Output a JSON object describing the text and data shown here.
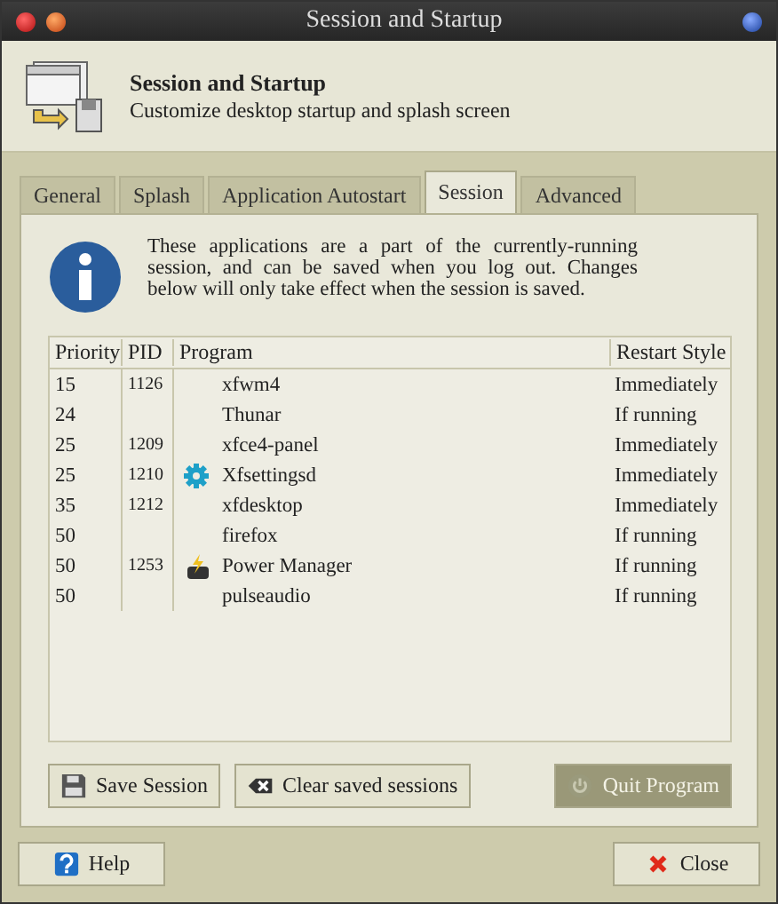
{
  "window": {
    "title": "Session and Startup"
  },
  "header": {
    "title": "Session and Startup",
    "subtitle": "Customize desktop startup and splash screen"
  },
  "tabs": [
    {
      "label": "General",
      "selected": false
    },
    {
      "label": "Splash",
      "selected": false
    },
    {
      "label": "Application Autostart",
      "selected": false
    },
    {
      "label": "Session",
      "selected": true
    },
    {
      "label": "Advanced",
      "selected": false
    }
  ],
  "info": "These applications are a part of the currently-running session, and can be saved when you log out. Changes below will only take effect when the session is saved.",
  "table": {
    "columns": [
      "Priority",
      "PID",
      "Program",
      "Restart Style"
    ],
    "rows": [
      {
        "priority": "15",
        "pid": "1126",
        "program": "xfwm4",
        "restart": "Immediately",
        "kind": "plain"
      },
      {
        "priority": "24",
        "pid": "",
        "program": "Thunar",
        "restart": "If running",
        "kind": "plain"
      },
      {
        "priority": "25",
        "pid": "1209",
        "program": "xfce4-panel",
        "restart": "Immediately",
        "kind": "plain"
      },
      {
        "priority": "25",
        "pid": "1210",
        "program": "Xfsettingsd",
        "restart": "Immediately",
        "kind": "gear"
      },
      {
        "priority": "35",
        "pid": "1212",
        "program": "xfdesktop",
        "restart": "Immediately",
        "kind": "plain"
      },
      {
        "priority": "50",
        "pid": "",
        "program": "firefox",
        "restart": "If running",
        "kind": "plain"
      },
      {
        "priority": "50",
        "pid": "1253",
        "program": "Power Manager",
        "restart": "If running",
        "kind": "power"
      },
      {
        "priority": "50",
        "pid": "",
        "program": "pulseaudio",
        "restart": "If running",
        "kind": "plain"
      }
    ]
  },
  "session_buttons": [
    {
      "label": "Save Session",
      "kind": "save",
      "disabled": false
    },
    {
      "label": "Clear saved sessions",
      "kind": "clear",
      "disabled": false
    },
    {
      "label": "Quit Program",
      "kind": "quit",
      "disabled": true
    }
  ],
  "footer_buttons": [
    {
      "label": "Help",
      "kind": "help"
    },
    {
      "label": "Close",
      "kind": "close"
    }
  ]
}
